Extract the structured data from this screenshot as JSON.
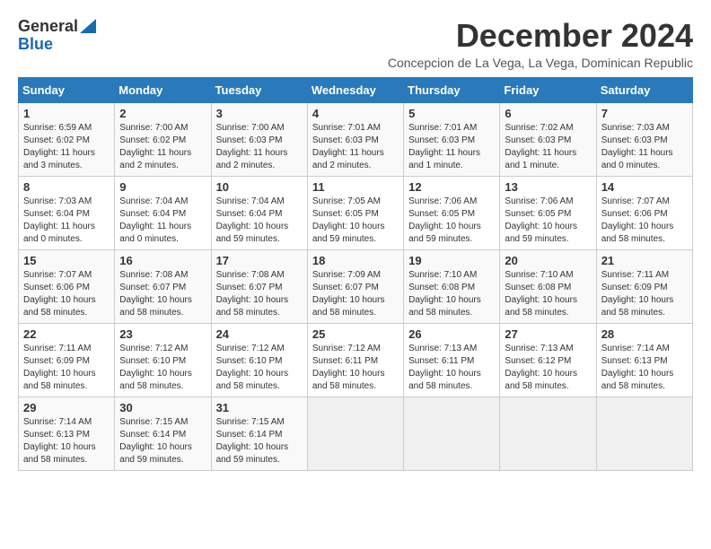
{
  "header": {
    "logo_general": "General",
    "logo_blue": "Blue",
    "month_title": "December 2024",
    "subtitle": "Concepcion de La Vega, La Vega, Dominican Republic"
  },
  "days_of_week": [
    "Sunday",
    "Monday",
    "Tuesday",
    "Wednesday",
    "Thursday",
    "Friday",
    "Saturday"
  ],
  "weeks": [
    [
      {
        "day": "1",
        "detail": "Sunrise: 6:59 AM\nSunset: 6:02 PM\nDaylight: 11 hours and 3 minutes."
      },
      {
        "day": "2",
        "detail": "Sunrise: 7:00 AM\nSunset: 6:02 PM\nDaylight: 11 hours and 2 minutes."
      },
      {
        "day": "3",
        "detail": "Sunrise: 7:00 AM\nSunset: 6:03 PM\nDaylight: 11 hours and 2 minutes."
      },
      {
        "day": "4",
        "detail": "Sunrise: 7:01 AM\nSunset: 6:03 PM\nDaylight: 11 hours and 2 minutes."
      },
      {
        "day": "5",
        "detail": "Sunrise: 7:01 AM\nSunset: 6:03 PM\nDaylight: 11 hours and 1 minute."
      },
      {
        "day": "6",
        "detail": "Sunrise: 7:02 AM\nSunset: 6:03 PM\nDaylight: 11 hours and 1 minute."
      },
      {
        "day": "7",
        "detail": "Sunrise: 7:03 AM\nSunset: 6:03 PM\nDaylight: 11 hours and 0 minutes."
      }
    ],
    [
      {
        "day": "8",
        "detail": "Sunrise: 7:03 AM\nSunset: 6:04 PM\nDaylight: 11 hours and 0 minutes."
      },
      {
        "day": "9",
        "detail": "Sunrise: 7:04 AM\nSunset: 6:04 PM\nDaylight: 11 hours and 0 minutes."
      },
      {
        "day": "10",
        "detail": "Sunrise: 7:04 AM\nSunset: 6:04 PM\nDaylight: 10 hours and 59 minutes."
      },
      {
        "day": "11",
        "detail": "Sunrise: 7:05 AM\nSunset: 6:05 PM\nDaylight: 10 hours and 59 minutes."
      },
      {
        "day": "12",
        "detail": "Sunrise: 7:06 AM\nSunset: 6:05 PM\nDaylight: 10 hours and 59 minutes."
      },
      {
        "day": "13",
        "detail": "Sunrise: 7:06 AM\nSunset: 6:05 PM\nDaylight: 10 hours and 59 minutes."
      },
      {
        "day": "14",
        "detail": "Sunrise: 7:07 AM\nSunset: 6:06 PM\nDaylight: 10 hours and 58 minutes."
      }
    ],
    [
      {
        "day": "15",
        "detail": "Sunrise: 7:07 AM\nSunset: 6:06 PM\nDaylight: 10 hours and 58 minutes."
      },
      {
        "day": "16",
        "detail": "Sunrise: 7:08 AM\nSunset: 6:07 PM\nDaylight: 10 hours and 58 minutes."
      },
      {
        "day": "17",
        "detail": "Sunrise: 7:08 AM\nSunset: 6:07 PM\nDaylight: 10 hours and 58 minutes."
      },
      {
        "day": "18",
        "detail": "Sunrise: 7:09 AM\nSunset: 6:07 PM\nDaylight: 10 hours and 58 minutes."
      },
      {
        "day": "19",
        "detail": "Sunrise: 7:10 AM\nSunset: 6:08 PM\nDaylight: 10 hours and 58 minutes."
      },
      {
        "day": "20",
        "detail": "Sunrise: 7:10 AM\nSunset: 6:08 PM\nDaylight: 10 hours and 58 minutes."
      },
      {
        "day": "21",
        "detail": "Sunrise: 7:11 AM\nSunset: 6:09 PM\nDaylight: 10 hours and 58 minutes."
      }
    ],
    [
      {
        "day": "22",
        "detail": "Sunrise: 7:11 AM\nSunset: 6:09 PM\nDaylight: 10 hours and 58 minutes."
      },
      {
        "day": "23",
        "detail": "Sunrise: 7:12 AM\nSunset: 6:10 PM\nDaylight: 10 hours and 58 minutes."
      },
      {
        "day": "24",
        "detail": "Sunrise: 7:12 AM\nSunset: 6:10 PM\nDaylight: 10 hours and 58 minutes."
      },
      {
        "day": "25",
        "detail": "Sunrise: 7:12 AM\nSunset: 6:11 PM\nDaylight: 10 hours and 58 minutes."
      },
      {
        "day": "26",
        "detail": "Sunrise: 7:13 AM\nSunset: 6:11 PM\nDaylight: 10 hours and 58 minutes."
      },
      {
        "day": "27",
        "detail": "Sunrise: 7:13 AM\nSunset: 6:12 PM\nDaylight: 10 hours and 58 minutes."
      },
      {
        "day": "28",
        "detail": "Sunrise: 7:14 AM\nSunset: 6:13 PM\nDaylight: 10 hours and 58 minutes."
      }
    ],
    [
      {
        "day": "29",
        "detail": "Sunrise: 7:14 AM\nSunset: 6:13 PM\nDaylight: 10 hours and 58 minutes."
      },
      {
        "day": "30",
        "detail": "Sunrise: 7:15 AM\nSunset: 6:14 PM\nDaylight: 10 hours and 59 minutes."
      },
      {
        "day": "31",
        "detail": "Sunrise: 7:15 AM\nSunset: 6:14 PM\nDaylight: 10 hours and 59 minutes."
      },
      null,
      null,
      null,
      null
    ]
  ]
}
